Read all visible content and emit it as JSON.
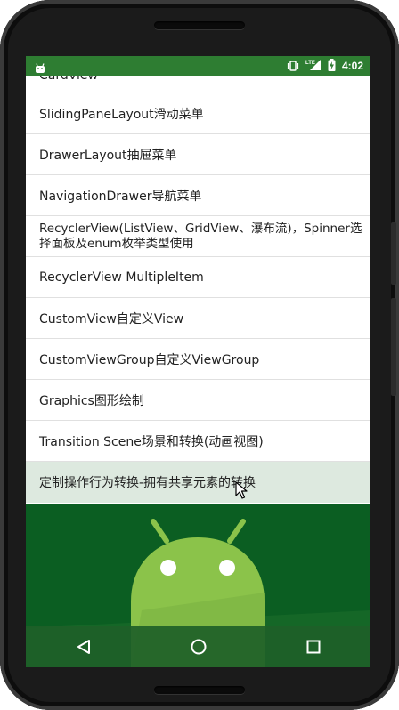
{
  "status_bar": {
    "time": "4:02",
    "icons": [
      "android-notification-icon",
      "vibrate-icon",
      "lte-signal-icon",
      "battery-charging-icon"
    ],
    "lte_label": "LTE"
  },
  "list": {
    "items": [
      {
        "label": "CardView"
      },
      {
        "label": "SlidingPaneLayout滑动菜单"
      },
      {
        "label": "DrawerLayout抽屉菜单"
      },
      {
        "label": "NavigationDrawer导航菜单"
      },
      {
        "label": "RecyclerView(ListView、GridView、瀑布流)，Spinner选择面板及enum枚举类型使用"
      },
      {
        "label": "RecyclerView MultipleItem"
      },
      {
        "label": "CustomView自定义View"
      },
      {
        "label": "CustomViewGroup自定义ViewGroup"
      },
      {
        "label": "Graphics图形绘制"
      },
      {
        "label": "Transition Scene场景和转换(动画视图)"
      },
      {
        "label": "定制操作行为转换-拥有共享元素的转换"
      }
    ]
  },
  "nav_bar": {
    "buttons": [
      "back-icon",
      "home-icon",
      "recents-icon"
    ]
  },
  "colors": {
    "status_bar": "#2e7d32",
    "selected_row": "#dde9df",
    "hero_background": "#0b5e22",
    "android_green": "#8bc34a"
  }
}
